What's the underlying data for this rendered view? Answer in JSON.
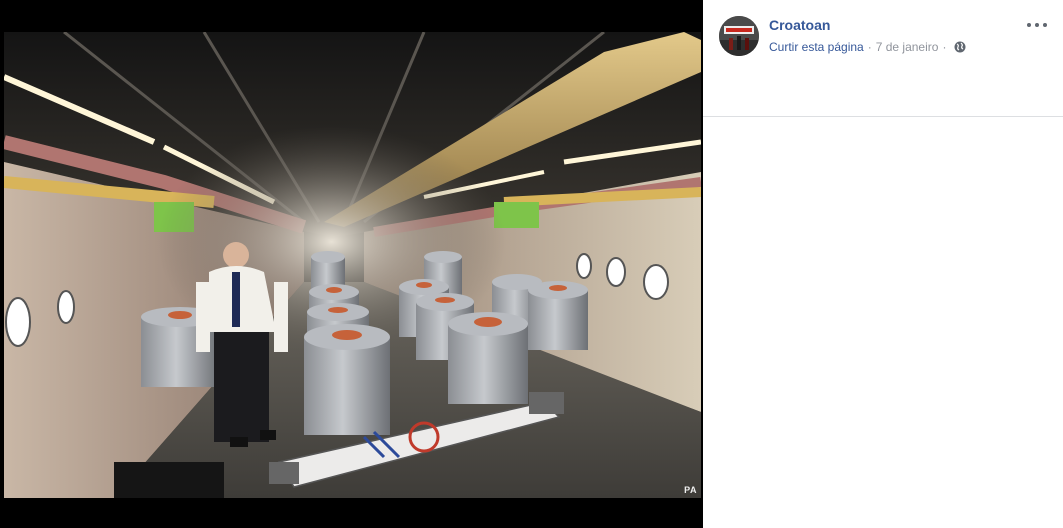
{
  "photo": {
    "credit": "PA",
    "alt_subject": "aircraft-cabin-ballast-tanks"
  },
  "post": {
    "page_name": "Croatoan",
    "avatar_text": "CROATOAN",
    "like_link": "Curtir esta página",
    "separator": "·",
    "date": "7 de janeiro",
    "privacy_icon": "globe-icon",
    "more_icon": "more-options-icon"
  },
  "colors": {
    "link": "#365899",
    "meta": "#90949c",
    "divider": "#dddfe2",
    "viewer_bg": "#000000"
  }
}
